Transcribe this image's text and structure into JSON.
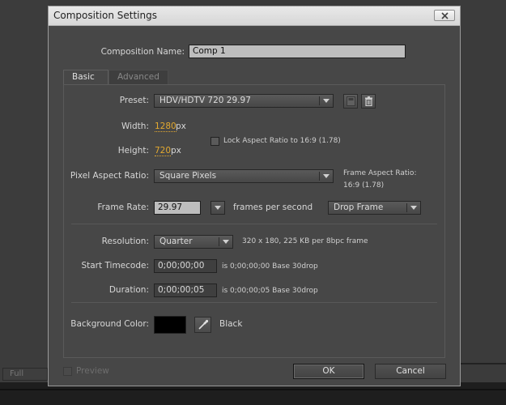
{
  "background": {
    "full_label": "Full"
  },
  "dialog": {
    "title": "Composition Settings",
    "comp_name_label": "Composition Name:",
    "comp_name_value": "Comp 1",
    "tabs": [
      {
        "label": "Basic"
      },
      {
        "label": "Advanced"
      }
    ],
    "preset": {
      "label": "Preset:",
      "value": "HDV/HDTV 720 29.97"
    },
    "width": {
      "label": "Width:",
      "value": "1280",
      "unit": "px"
    },
    "height": {
      "label": "Height:",
      "value": "720",
      "unit": "px"
    },
    "lock_aspect": {
      "label": "Lock Aspect Ratio to 16:9 (1.78)",
      "checked": false
    },
    "pixel_aspect": {
      "label": "Pixel Aspect Ratio:",
      "value": "Square Pixels"
    },
    "frame_aspect": {
      "label": "Frame Aspect Ratio:",
      "value": "16:9 (1.78)"
    },
    "frame_rate": {
      "label": "Frame Rate:",
      "value": "29.97",
      "unit": "frames per second",
      "drop_frame": "Drop Frame"
    },
    "resolution": {
      "label": "Resolution:",
      "value": "Quarter",
      "info": "320 x 180, 225 KB per 8bpc frame"
    },
    "start_timecode": {
      "label": "Start Timecode:",
      "value": "0;00;00;00",
      "info": "is 0;00;00;00  Base 30drop"
    },
    "duration": {
      "label": "Duration:",
      "value": "0;00;00;05",
      "info": "is 0;00;00;05  Base 30drop"
    },
    "background_color": {
      "label": "Background Color:",
      "name": "Black",
      "hex": "#000000"
    },
    "preview": {
      "label": "Preview",
      "checked": false
    },
    "ok_label": "OK",
    "cancel_label": "Cancel"
  }
}
